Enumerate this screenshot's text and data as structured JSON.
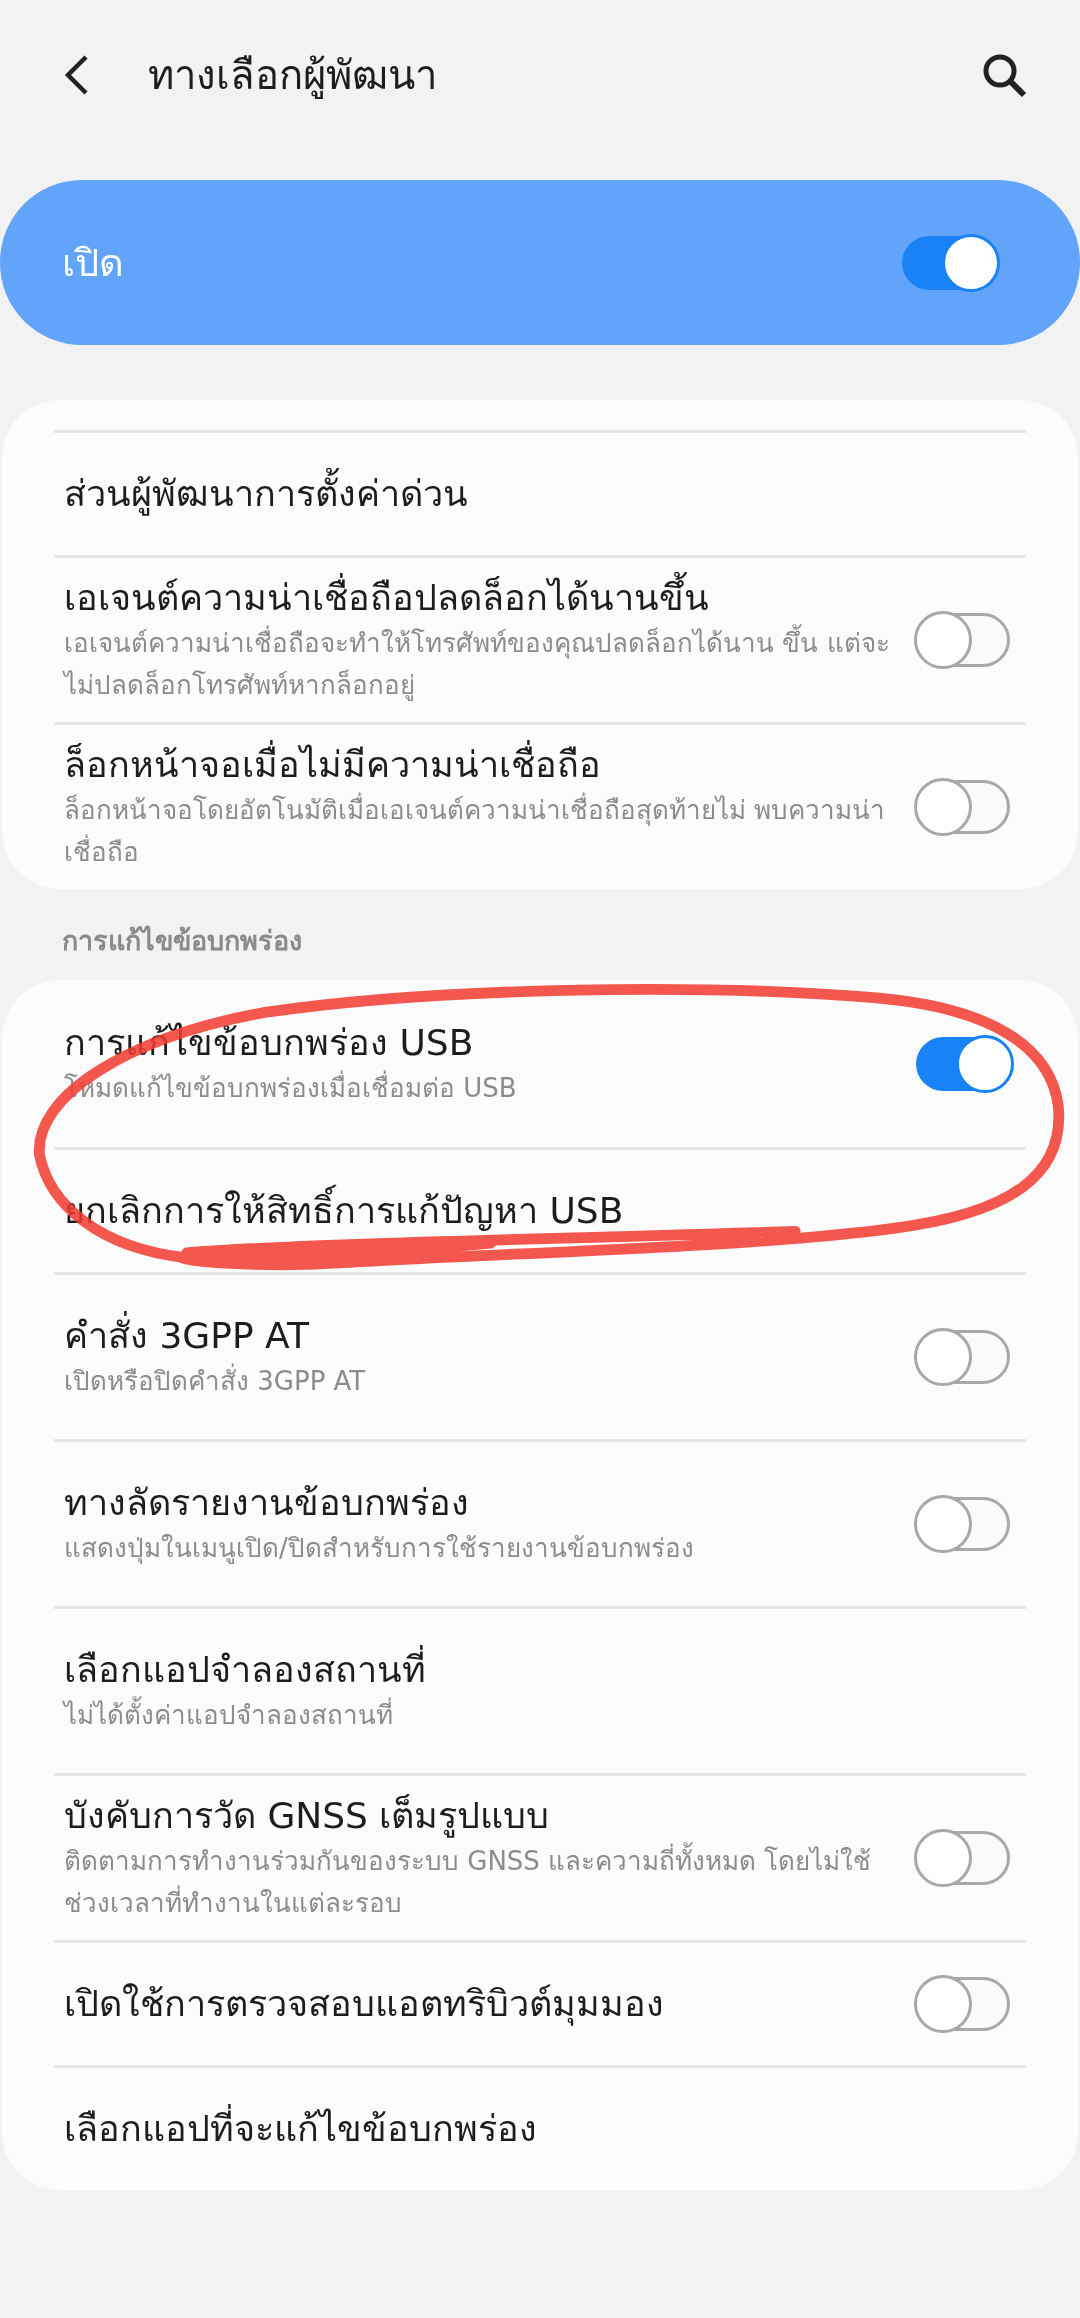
{
  "header": {
    "title": "ทางเลือกผู้พัฒนา"
  },
  "master": {
    "label": "เปิด",
    "on": true
  },
  "groups": [
    {
      "items": [
        {
          "kind": "link",
          "title": "ส่วนผู้พัฒนาการตั้งค่าด่วน"
        },
        {
          "kind": "toggle",
          "title": "เอเจนต์ความน่าเชื่อถือปลดล็อกได้นานขึ้น",
          "subtitle": "เอเจนต์ความน่าเชื่อถือจะทำให้โทรศัพท์ของคุณปลดล็อกได้นาน ขึ้น แต่จะไม่ปลดล็อกโทรศัพท์หากล็อกอยู่",
          "on": false
        },
        {
          "kind": "toggle",
          "title": "ล็อกหน้าจอเมื่อไม่มีความน่าเชื่อถือ",
          "subtitle": "ล็อกหน้าจอโดยอัตโนมัติเมื่อเอเจนต์ความน่าเชื่อถือสุดท้ายไม่ พบความน่าเชื่อถือ",
          "on": false
        }
      ]
    },
    {
      "heading": "การแก้ไขข้อบกพร่อง",
      "items": [
        {
          "kind": "toggle",
          "title": "การแก้ไขข้อบกพร่อง USB",
          "subtitle": "โหมดแก้ไขข้อบกพร่องเมื่อเชื่อมต่อ USB",
          "on": true
        },
        {
          "kind": "link",
          "title": "ยกเลิกการให้สิทธิ์การแก้ปัญหา USB"
        },
        {
          "kind": "toggle",
          "title": "คำสั่ง 3GPP AT",
          "subtitle": "เปิดหรือปิดคำสั่ง 3GPP AT",
          "on": false
        },
        {
          "kind": "toggle",
          "title": "ทางลัดรายงานข้อบกพร่อง",
          "subtitle": "แสดงปุ่มในเมนูเปิด/ปิดสำหรับการใช้รายงานข้อบกพร่อง",
          "on": false
        },
        {
          "kind": "link",
          "title": "เลือกแอปจำลองสถานที่",
          "subtitle": "ไม่ได้ตั้งค่าแอปจำลองสถานที่"
        },
        {
          "kind": "toggle",
          "title": "บังคับการวัด GNSS เต็มรูปแบบ",
          "subtitle": "ติดตามการทำงานร่วมกันของระบบ GNSS และความถี่ทั้งหมด โดยไม่ใช้ช่วงเวลาที่ทำงานในแต่ละรอบ",
          "on": false
        },
        {
          "kind": "toggle",
          "title": "เปิดใช้การตรวจสอบแอตทริบิวต์มุมมอง",
          "on": false
        },
        {
          "kind": "link",
          "title": "เลือกแอปที่จะแก้ไขข้อบกพร่อง"
        }
      ]
    }
  ]
}
